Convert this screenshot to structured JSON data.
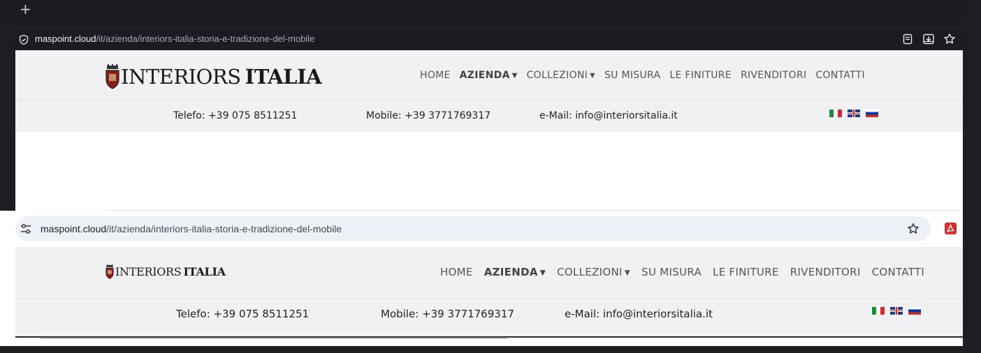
{
  "firefox": {
    "new_tab_glyph": "+",
    "url_host": "maspoint.cloud",
    "url_path": "/it/azienda/interiors-italia-storia-e-tradizione-del-mobile",
    "icons": [
      "shield-icon",
      "reader-view-icon",
      "save-to-pocket-icon",
      "bookmark-star-icon"
    ]
  },
  "chrome": {
    "url_host": "maspoint.cloud",
    "url_path": "/it/azienda/interiors-italia-storia-e-tradizione-del-mobile",
    "icons": [
      "site-settings-icon",
      "bookmark-star-icon",
      "pdf-extension-icon"
    ]
  },
  "site": {
    "logo_text_1": "INTERIORS",
    "logo_text_2": "ITALIA",
    "nav": [
      {
        "label": "HOME",
        "dropdown": false,
        "active": false
      },
      {
        "label": "AZIENDA",
        "dropdown": true,
        "active": true
      },
      {
        "label": "COLLEZIONI",
        "dropdown": true,
        "active": false
      },
      {
        "label": "SU MISURA",
        "dropdown": false,
        "active": false
      },
      {
        "label": "LE FINITURE",
        "dropdown": false,
        "active": false
      },
      {
        "label": "RIVENDITORI",
        "dropdown": false,
        "active": false
      },
      {
        "label": "CONTATTI",
        "dropdown": false,
        "active": false
      }
    ],
    "phone": "Telefo: +39 075 8511251",
    "mobile": "Mobile: +39 3771769317",
    "email": "e-Mail: info@interiorsitalia.it",
    "flags": [
      "flag-italy-icon",
      "flag-uk-icon",
      "flag-russia-icon"
    ]
  },
  "colors": {
    "firefox_chrome_bg": "#1c1b22",
    "site_bg": "#f1f1f3",
    "chrome_urlbar_bg": "#eef1f8",
    "pdf_red": "#d32f2f"
  }
}
